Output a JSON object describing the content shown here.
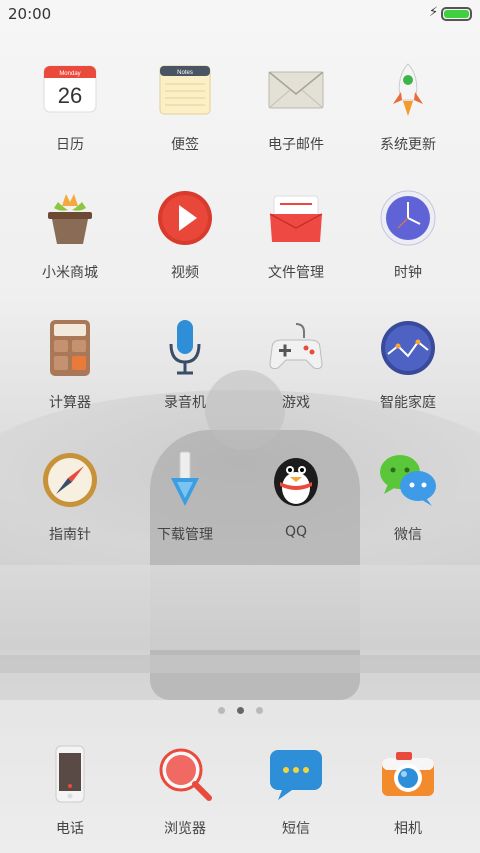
{
  "status_bar": {
    "time": "20:00",
    "battery_level": 1.0,
    "charging": true
  },
  "apps": [
    {
      "name": "calendar",
      "label": "日历",
      "icon": "calendar-icon",
      "date": "26",
      "month": "Monday"
    },
    {
      "name": "notes",
      "label": "便签",
      "icon": "notes-icon",
      "title": "Notes"
    },
    {
      "name": "email",
      "label": "电子邮件",
      "icon": "envelope-icon"
    },
    {
      "name": "system-update",
      "label": "系统更新",
      "icon": "rocket-icon"
    },
    {
      "name": "mi-store",
      "label": "小米商城",
      "icon": "plant-pot-icon"
    },
    {
      "name": "video",
      "label": "视频",
      "icon": "play-icon"
    },
    {
      "name": "file-manager",
      "label": "文件管理",
      "icon": "folder-icon"
    },
    {
      "name": "clock",
      "label": "时钟",
      "icon": "clock-icon"
    },
    {
      "name": "calculator",
      "label": "计算器",
      "icon": "calculator-icon"
    },
    {
      "name": "recorder",
      "label": "录音机",
      "icon": "microphone-icon"
    },
    {
      "name": "games",
      "label": "游戏",
      "icon": "gamepad-icon"
    },
    {
      "name": "smart-home",
      "label": "智能家庭",
      "icon": "smart-home-icon"
    },
    {
      "name": "compass",
      "label": "指南针",
      "icon": "compass-icon"
    },
    {
      "name": "downloads",
      "label": "下载管理",
      "icon": "download-icon"
    },
    {
      "name": "qq",
      "label": "QQ",
      "icon": "penguin-icon"
    },
    {
      "name": "wechat",
      "label": "微信",
      "icon": "wechat-icon"
    }
  ],
  "dock": [
    {
      "name": "phone",
      "label": "电话",
      "icon": "phone-icon"
    },
    {
      "name": "browser",
      "label": "浏览器",
      "icon": "magnifier-icon"
    },
    {
      "name": "messages",
      "label": "短信",
      "icon": "chat-bubble-icon"
    },
    {
      "name": "camera",
      "label": "相机",
      "icon": "camera-icon"
    }
  ],
  "page_indicator": {
    "count": 3,
    "active": 1
  },
  "colors": {
    "accent_red": "#e94a3c",
    "battery_green": "#3fcf3f",
    "label_text": "#444444"
  }
}
